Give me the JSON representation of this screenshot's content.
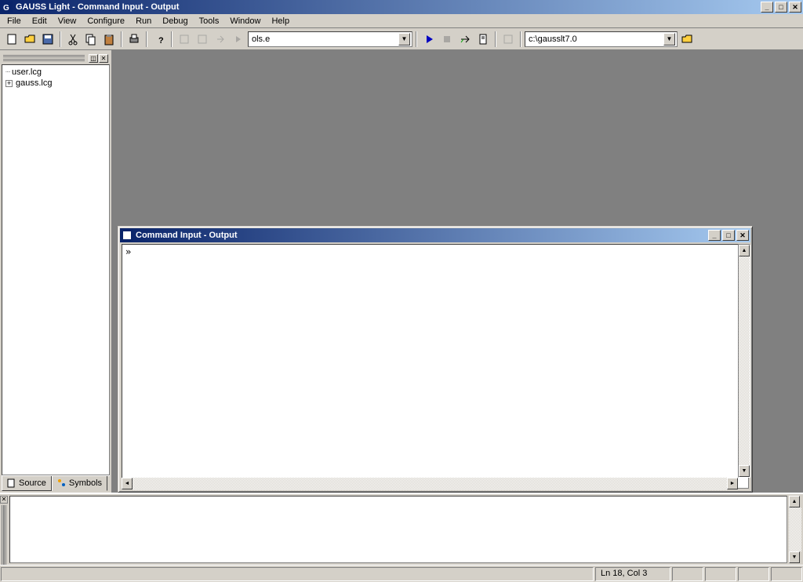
{
  "window": {
    "title": "GAUSS Light - Command Input - Output"
  },
  "menu": [
    "File",
    "Edit",
    "View",
    "Configure",
    "Run",
    "Debug",
    "Tools",
    "Window",
    "Help"
  ],
  "toolbar": {
    "file_combo": "ols.e",
    "path_combo": "c:\\gausslt7.0"
  },
  "sidebar": {
    "items": [
      {
        "label": "user.lcg",
        "expandable": false
      },
      {
        "label": "gauss.lcg",
        "expandable": true
      }
    ],
    "tabs": [
      {
        "label": "Source"
      },
      {
        "label": "Symbols"
      }
    ]
  },
  "mdi_child": {
    "title": "Command Input - Output",
    "prompt": "»"
  },
  "status": {
    "position": "Ln 18, Col 3"
  }
}
